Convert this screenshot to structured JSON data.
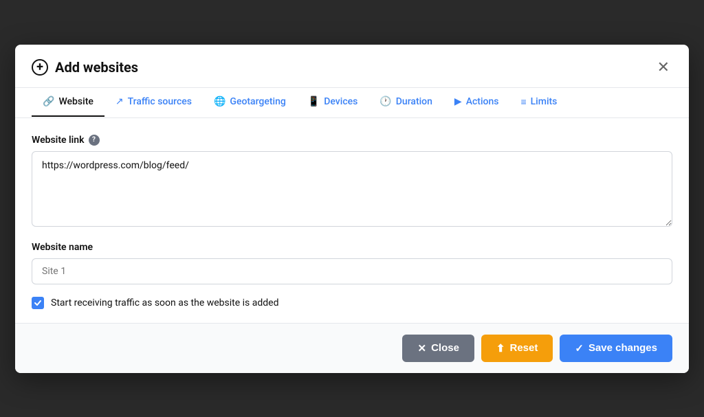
{
  "modal": {
    "title": "Add websites",
    "close_label": "✕",
    "tabs": [
      {
        "id": "website",
        "label": "Website",
        "icon": "🔗",
        "active": true
      },
      {
        "id": "traffic-sources",
        "label": "Traffic sources",
        "icon": "↗"
      },
      {
        "id": "geotargeting",
        "label": "Geotargeting",
        "icon": "🌐"
      },
      {
        "id": "devices",
        "label": "Devices",
        "icon": "📱"
      },
      {
        "id": "duration",
        "label": "Duration",
        "icon": "🕐"
      },
      {
        "id": "actions",
        "label": "Actions",
        "icon": "▶"
      },
      {
        "id": "limits",
        "label": "Limits",
        "icon": "≡"
      }
    ],
    "fields": {
      "website_link_label": "Website link",
      "website_link_value": "https://wordpress.com/blog/feed/",
      "website_name_label": "Website name",
      "website_name_placeholder": "Site 1",
      "checkbox_label": "Start receiving traffic as soon as the website is added"
    },
    "footer": {
      "close_label": "Close",
      "reset_label": "Reset",
      "save_label": "Save changes"
    }
  }
}
